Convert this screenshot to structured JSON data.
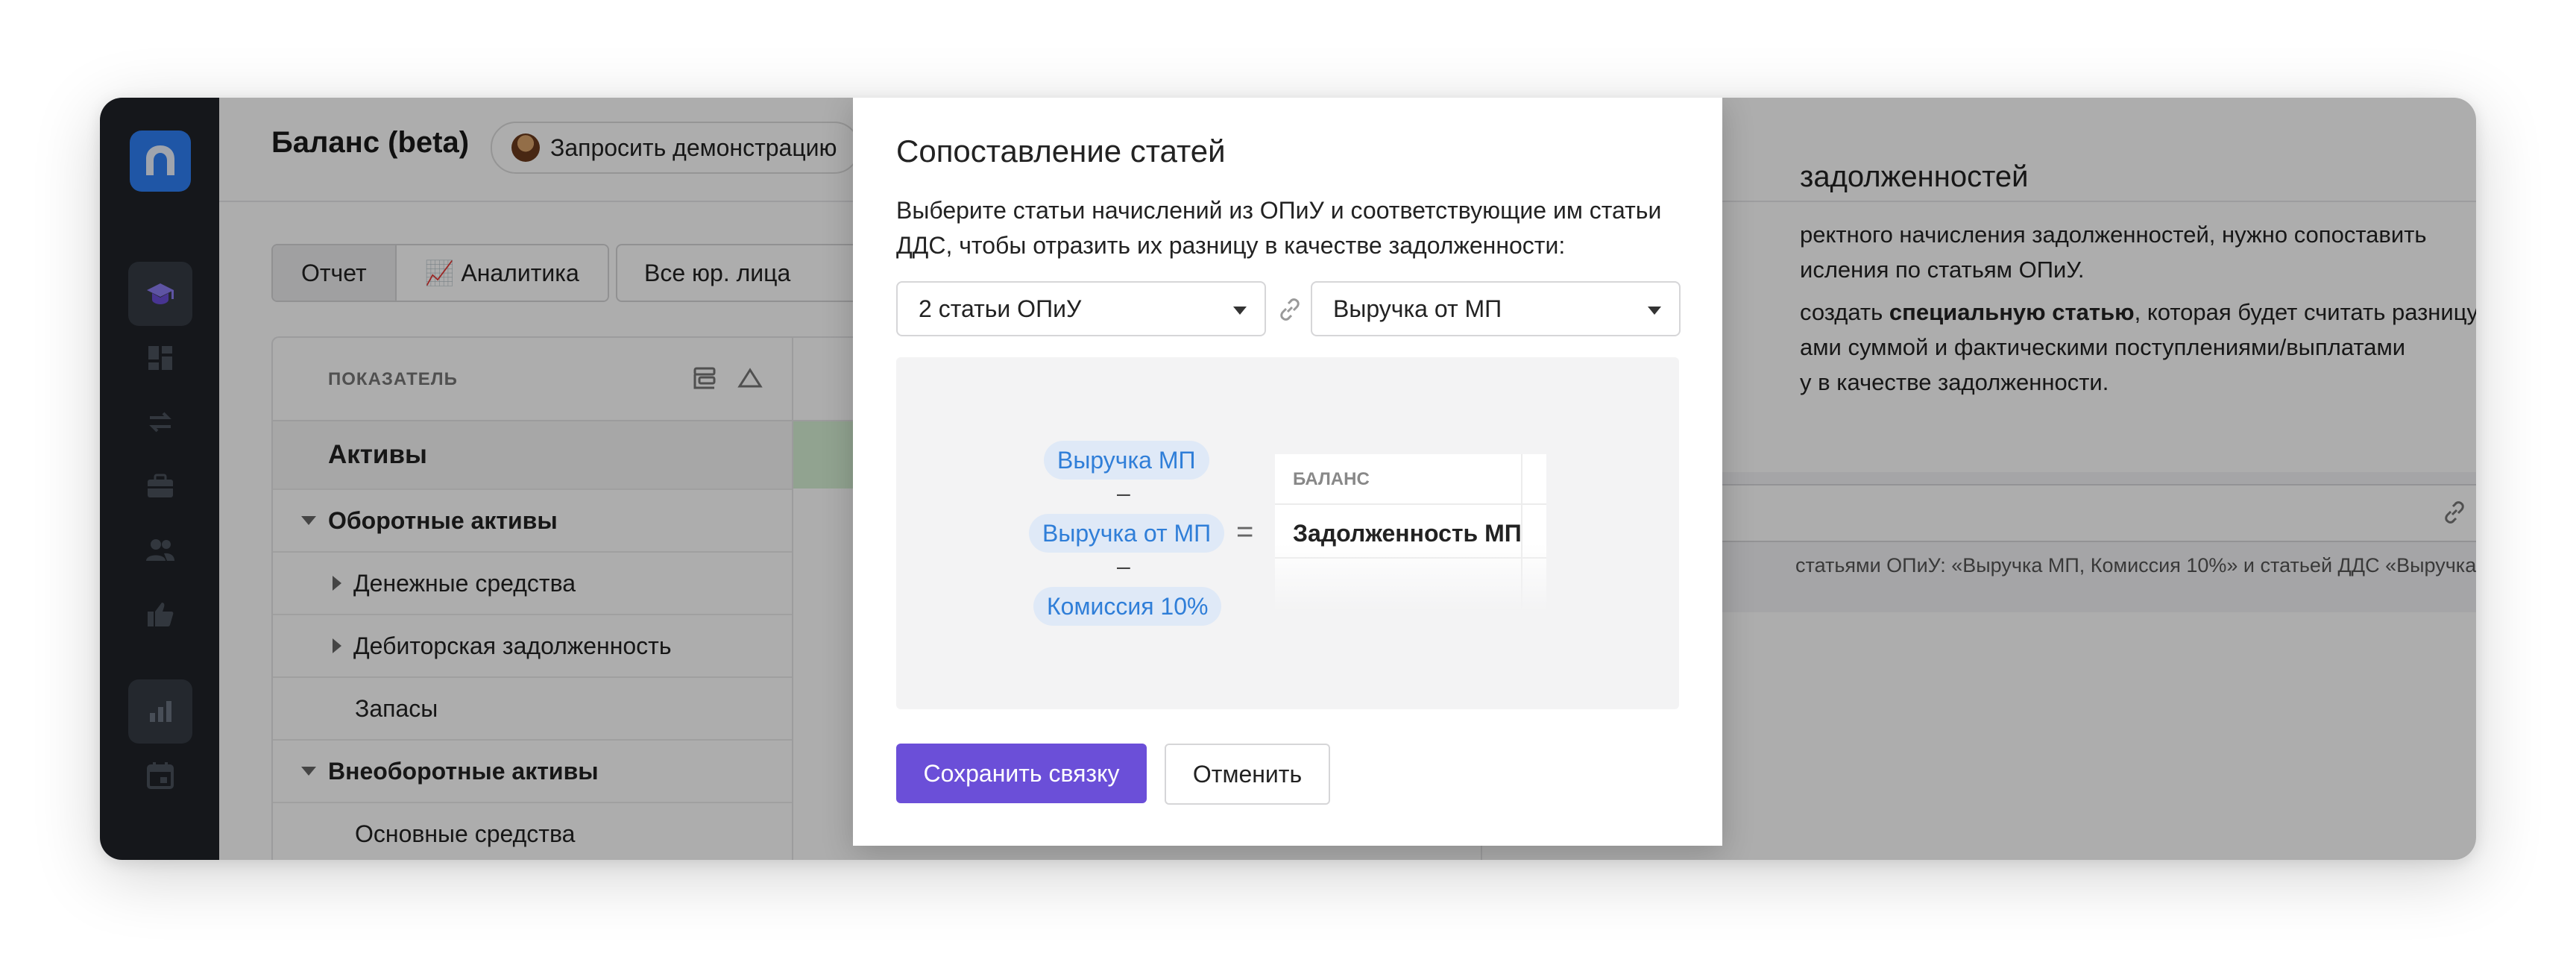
{
  "app": {
    "title": "Баланс (beta)",
    "demo_button": "Запросить демонстрацию"
  },
  "toolbar": {
    "tab_report": "Отчет",
    "tab_analytics": "📈 Аналитика",
    "entity_select": "Все юр. лица"
  },
  "table": {
    "header": "ПОКАЗАТЕЛЬ",
    "rows": [
      {
        "label": "Активы"
      },
      {
        "label": "Оборотные активы"
      },
      {
        "label": "Денежные средства"
      },
      {
        "label": "Дебиторская задолженность"
      },
      {
        "label": "Запасы"
      },
      {
        "label": "Внеоборотные активы"
      },
      {
        "label": "Основные средства"
      }
    ]
  },
  "side_panel": {
    "title_fragment": "задолженностей",
    "line1": "ректного начисления задолженностей, нужно сопоставить",
    "line2": "исления по статьям ОПиУ.",
    "line3a": "создать ",
    "line3b": "специальную статью",
    "line3c": ", которая будет считать разницу",
    "line4": "ами суммой и фактическими поступлениями/выплатами",
    "line5": "у в качестве задолженности.",
    "link_desc": "статьями ОПиУ: «Выручка МП, Комиссия 10%» и статьей ДДС «Выручка"
  },
  "modal": {
    "title": "Сопоставление статей",
    "description": "Выберите статьи начислений из ОПиУ и соответствующие им статьи ДДС, чтобы отразить их разницу в качестве задолженности:",
    "select_left": "2 статьи ОПиУ",
    "select_right": "Выручка от МП",
    "illustration": {
      "pill1": "Выручка МП",
      "minus1": "–",
      "pill2": "Выручка от МП",
      "minus2": "–",
      "pill3": "Комиссия 10%",
      "equals": "=",
      "table_header": "БАЛАНС",
      "table_row": "Задолженность МП"
    },
    "save_button": "Сохранить связку",
    "cancel_button": "Отменить"
  },
  "colors": {
    "accent": "#6b4fd8",
    "sidebar": "#1f2329",
    "pill_text": "#2f7ed8",
    "pill_bg": "#dfe9f7"
  }
}
